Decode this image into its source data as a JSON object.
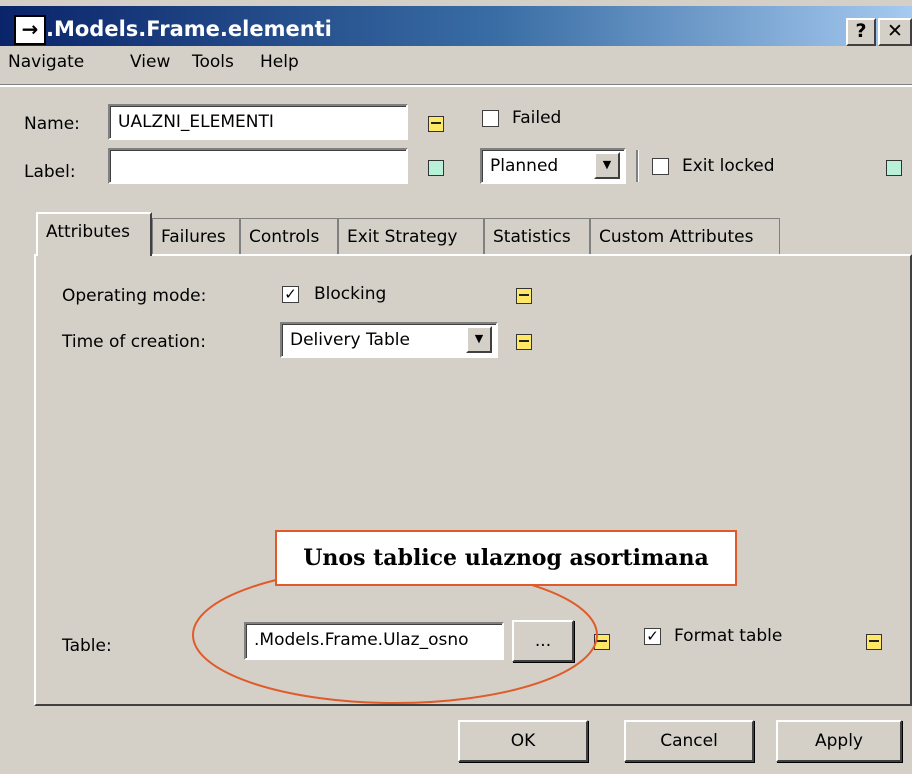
{
  "window": {
    "title": ".Models.Frame.elementi",
    "title_icon": "→",
    "help_button": "?",
    "close_button": "✕"
  },
  "menu": [
    "Navigate",
    "View",
    "Tools",
    "Help"
  ],
  "header": {
    "name_label": "Name:",
    "name_value": "UALZNI_ELEMENTI",
    "label_label": "Label:",
    "label_value": "",
    "failed_label": "Failed",
    "failed_checked": false,
    "state_value": "Planned",
    "exit_locked_label": "Exit locked",
    "exit_locked_checked": false
  },
  "tabs": [
    {
      "label": "Attributes",
      "active": true
    },
    {
      "label": "Failures"
    },
    {
      "label": "Controls"
    },
    {
      "label": "Exit Strategy"
    },
    {
      "label": "Statistics"
    },
    {
      "label": "Custom Attributes"
    }
  ],
  "attributes": {
    "operating_mode_label": "Operating mode:",
    "blocking_label": "Blocking",
    "blocking_checked": true,
    "time_of_creation_label": "Time of creation:",
    "time_of_creation_value": "Delivery Table",
    "table_label": "Table:",
    "table_value": ".Models.Frame.Ulaz_osno",
    "browse_button": "...",
    "format_table_label": "Format table",
    "format_table_checked": true
  },
  "annotation": {
    "callout_text": "Unos tablice ulaznog asortimana",
    "accent_color": "#e05a2a"
  },
  "footer": {
    "ok_label": "OK",
    "cancel_label": "Cancel",
    "apply_label": "Apply"
  },
  "colors": {
    "title_bar": "#0a246a",
    "dialog_bg": "#d4d0c8",
    "marker_yellow": "#ffe866",
    "marker_green": "#b8f0d8"
  }
}
